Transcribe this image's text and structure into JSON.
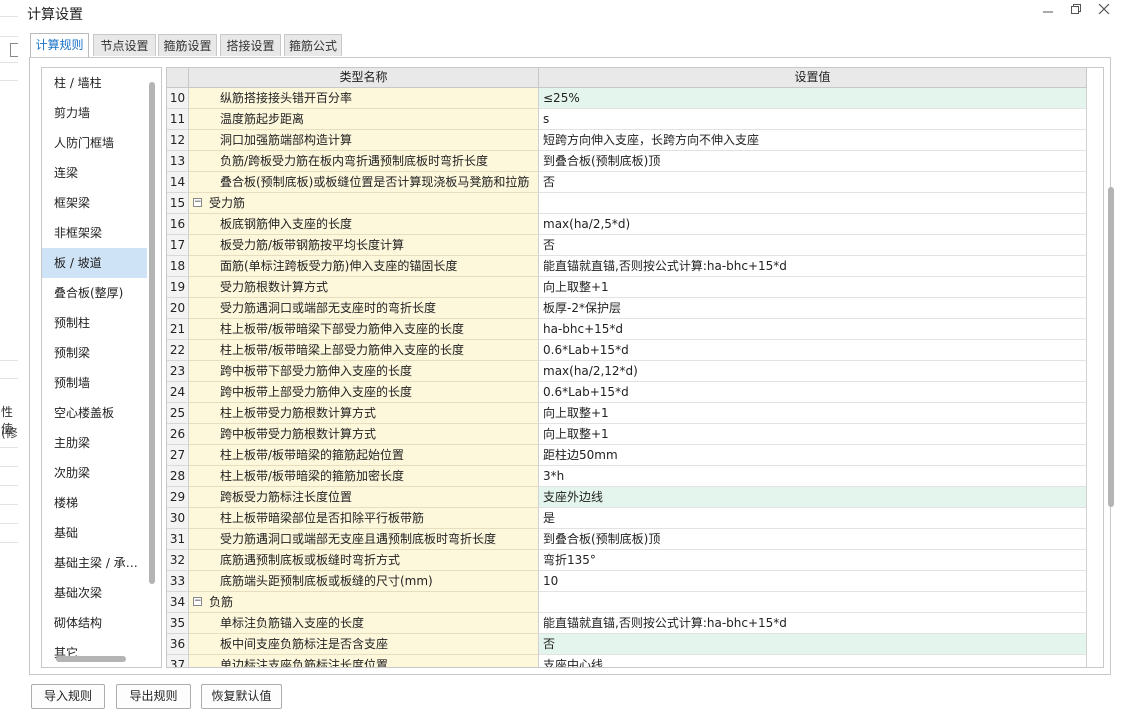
{
  "window": {
    "title": "计算设置"
  },
  "background": {
    "texts": [
      "性值",
      "(修"
    ]
  },
  "tabs": [
    {
      "label": "计算规则",
      "active": true
    },
    {
      "label": "节点设置",
      "active": false
    },
    {
      "label": "箍筋设置",
      "active": false
    },
    {
      "label": "搭接设置",
      "active": false
    },
    {
      "label": "箍筋公式",
      "active": false
    }
  ],
  "left_list": {
    "selected": "板 / 坡道",
    "items": [
      "柱 / 墙柱",
      "剪力墙",
      "人防门框墙",
      "连梁",
      "框架梁",
      "非框架梁",
      "板 / 坡道",
      "叠合板(整厚)",
      "预制柱",
      "预制梁",
      "预制墙",
      "空心楼盖板",
      "主肋梁",
      "次肋梁",
      "楼梯",
      "基础",
      "基础主梁 / 承台梁",
      "基础次梁",
      "砌体结构",
      "其它"
    ]
  },
  "grid": {
    "columns": [
      "类型名称",
      "设置值"
    ],
    "rows": [
      {
        "num": "10",
        "name": "纵筋搭接接头错开百分率",
        "value": "≤25%",
        "hl": true
      },
      {
        "num": "11",
        "name": "温度筋起步距离",
        "value": "s"
      },
      {
        "num": "12",
        "name": "洞口加强筋端部构造计算",
        "value": "短跨方向伸入支座，长跨方向不伸入支座"
      },
      {
        "num": "13",
        "name": "负筋/跨板受力筋在板内弯折遇预制底板时弯折长度",
        "value": "到叠合板(预制底板)顶"
      },
      {
        "num": "14",
        "name": "叠合板(预制底板)或板缝位置是否计算现浇板马凳筋和拉筋",
        "value": "否"
      },
      {
        "num": "15",
        "name": "受力筋",
        "value": "",
        "group": true
      },
      {
        "num": "16",
        "name": "板底钢筋伸入支座的长度",
        "value": "max(ha/2,5*d)"
      },
      {
        "num": "17",
        "name": "板受力筋/板带钢筋按平均长度计算",
        "value": "否"
      },
      {
        "num": "18",
        "name": "面筋(单标注跨板受力筋)伸入支座的锚固长度",
        "value": "能直锚就直锚,否则按公式计算:ha-bhc+15*d"
      },
      {
        "num": "19",
        "name": "受力筋根数计算方式",
        "value": "向上取整+1"
      },
      {
        "num": "20",
        "name": "受力筋遇洞口或端部无支座时的弯折长度",
        "value": "板厚-2*保护层"
      },
      {
        "num": "21",
        "name": "柱上板带/板带暗梁下部受力筋伸入支座的长度",
        "value": "ha-bhc+15*d"
      },
      {
        "num": "22",
        "name": "柱上板带/板带暗梁上部受力筋伸入支座的长度",
        "value": "0.6*Lab+15*d"
      },
      {
        "num": "23",
        "name": "跨中板带下部受力筋伸入支座的长度",
        "value": "max(ha/2,12*d)"
      },
      {
        "num": "24",
        "name": "跨中板带上部受力筋伸入支座的长度",
        "value": "0.6*Lab+15*d"
      },
      {
        "num": "25",
        "name": "柱上板带受力筋根数计算方式",
        "value": "向上取整+1"
      },
      {
        "num": "26",
        "name": "跨中板带受力筋根数计算方式",
        "value": "向上取整+1"
      },
      {
        "num": "27",
        "name": "柱上板带/板带暗梁的箍筋起始位置",
        "value": "距柱边50mm"
      },
      {
        "num": "28",
        "name": "柱上板带/板带暗梁的箍筋加密长度",
        "value": "3*h"
      },
      {
        "num": "29",
        "name": "跨板受力筋标注长度位置",
        "value": "支座外边线",
        "hl": true
      },
      {
        "num": "30",
        "name": "柱上板带暗梁部位是否扣除平行板带筋",
        "value": "是"
      },
      {
        "num": "31",
        "name": "受力筋遇洞口或端部无支座且遇预制底板时弯折长度",
        "value": "到叠合板(预制底板)顶"
      },
      {
        "num": "32",
        "name": "底筋遇预制底板或板缝时弯折方式",
        "value": "弯折135°"
      },
      {
        "num": "33",
        "name": "底筋端头距预制底板或板缝的尺寸(mm)",
        "value": "10"
      },
      {
        "num": "34",
        "name": "负筋",
        "value": "",
        "group": true
      },
      {
        "num": "35",
        "name": "单标注负筋锚入支座的长度",
        "value": "能直锚就直锚,否则按公式计算:ha-bhc+15*d"
      },
      {
        "num": "36",
        "name": "板中间支座负筋标注是否含支座",
        "value": "否",
        "hl": true
      },
      {
        "num": "37",
        "name": "单边标注支座负筋标注长度位置",
        "value": "支座中心线"
      }
    ]
  },
  "buttons": {
    "import": "导入规则",
    "export": "导出规则",
    "restore": "恢复默认值"
  },
  "icons": {
    "minimize": "minimize-icon",
    "restore": "restore-window-icon",
    "close": "close-icon",
    "collapse": "collapse-minus-icon"
  }
}
